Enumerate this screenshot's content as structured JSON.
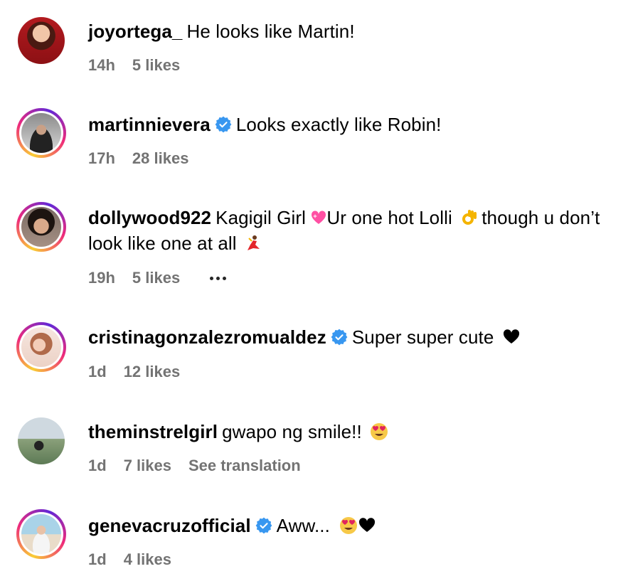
{
  "comments": [
    {
      "username": "joyortega_",
      "verified": false,
      "text": "He looks like Martin!",
      "time": "14h",
      "likes": "5 likes"
    },
    {
      "username": "martinnievera",
      "verified": true,
      "text": "Looks exactly like Robin!",
      "time": "17h",
      "likes": "28 likes"
    },
    {
      "username": "dollywood922",
      "verified": false,
      "text_part1": "Kagigil Girl",
      "text_part2": "Ur one hot Lolli",
      "text_part3": "though u don’t look like one at all",
      "time": "19h",
      "likes": "5 likes"
    },
    {
      "username": "cristinagonzalezromualdez",
      "verified": true,
      "text": "Super super cute",
      "time": "1d",
      "likes": "12 likes"
    },
    {
      "username": "theminstrelgirl",
      "verified": false,
      "text": "gwapo ng smile!!",
      "time": "1d",
      "likes": "7 likes",
      "see_translation": "See translation"
    },
    {
      "username": "genevacruzofficial",
      "verified": true,
      "text": "Aww...",
      "time": "1d",
      "likes": "4 likes"
    }
  ],
  "colors": {
    "verified_blue": "#3897f0",
    "meta_gray": "#737373",
    "heart": "#000000"
  },
  "icons": [
    "verified-badge-icon",
    "sparkling-heart-emoji",
    "ok-hand-emoji",
    "dancer-emoji",
    "black-heart-emoji",
    "heart-eyes-emoji",
    "more-options-icon"
  ]
}
